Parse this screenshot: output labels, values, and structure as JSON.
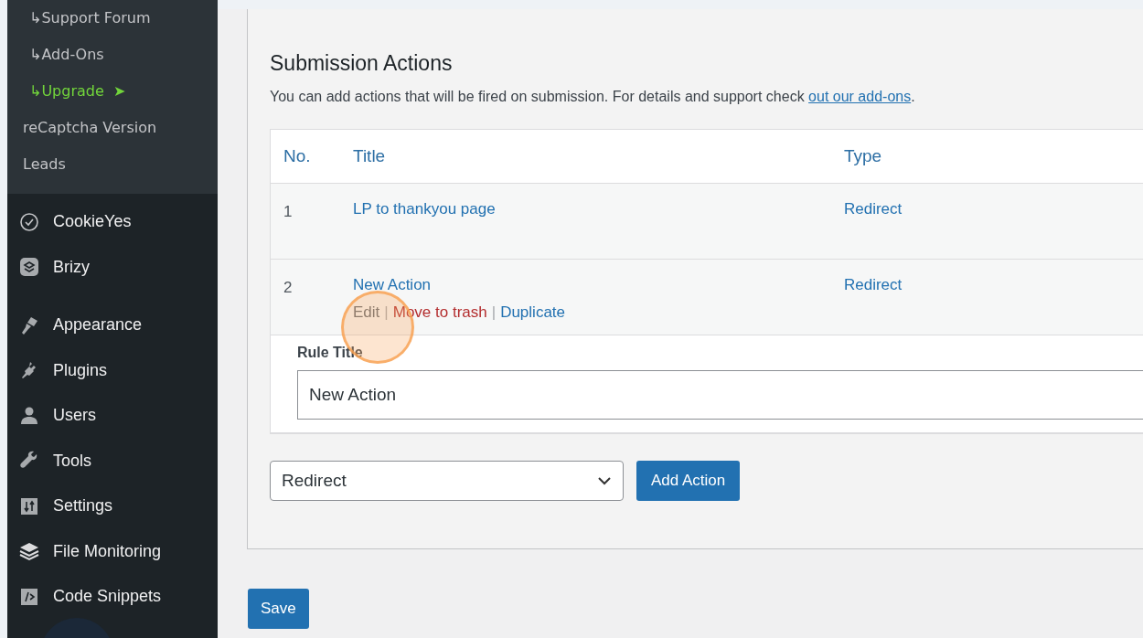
{
  "sidebar": {
    "submenu": [
      {
        "label": "Support Forum",
        "prefix": "↳",
        "highlighted": false
      },
      {
        "label": "Add-Ons",
        "prefix": "↳",
        "highlighted": false
      },
      {
        "label": "Upgrade",
        "prefix": "↳",
        "badge": "➤",
        "highlighted": true
      },
      {
        "label": "reCaptcha Version",
        "highlighted": false
      },
      {
        "label": "Leads",
        "highlighted": false
      }
    ],
    "menu": [
      {
        "label": "CookieYes"
      },
      {
        "label": "Brizy"
      },
      {
        "label": "Appearance"
      },
      {
        "label": "Plugins"
      },
      {
        "label": "Users"
      },
      {
        "label": "Tools"
      },
      {
        "label": "Settings"
      },
      {
        "label": "File Monitoring"
      },
      {
        "label": "Code Snippets"
      }
    ]
  },
  "main": {
    "heading": "Submission Actions",
    "description": {
      "text": "You can add actions that will be fired on submission. For details and support check",
      "link": "out our add-ons",
      "end": "."
    },
    "table": {
      "columns": [
        "No.",
        "Title",
        "Type"
      ],
      "rows": [
        {
          "no": "1",
          "title": "LP to thankyou page",
          "type": "Redirect"
        },
        {
          "no": "2",
          "title": "New Action",
          "type": "Redirect",
          "separator": "|",
          "row_actions": [
            {
              "label": "Edit",
              "kind": "edit"
            },
            {
              "label": "Move to trash",
              "kind": "trash"
            },
            {
              "label": "Duplicate",
              "kind": "link"
            }
          ],
          "expanded": true,
          "rule_title": {
            "label": "Rule Title",
            "value": "New Action"
          }
        }
      ]
    },
    "action_select": {
      "value": "Redirect"
    },
    "add_button": "Add Action",
    "save_button": "Save"
  }
}
